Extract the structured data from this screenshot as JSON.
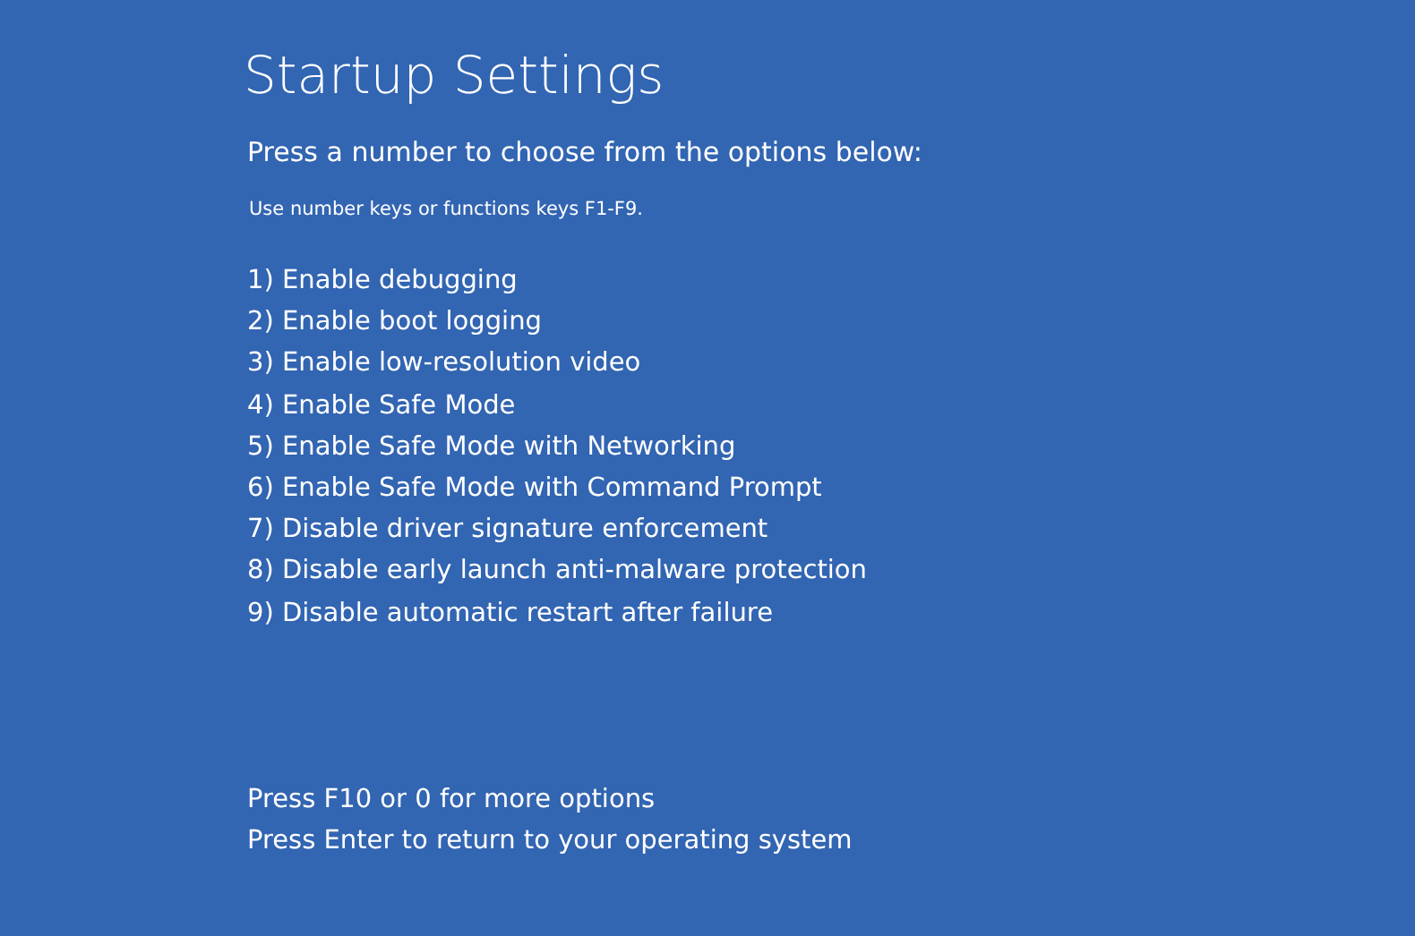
{
  "title": "Startup Settings",
  "prompt": "Press a number to choose from the options below:",
  "hint": "Use number keys or functions keys F1-F9.",
  "options": [
    "1) Enable debugging",
    "2) Enable boot logging",
    "3) Enable low-resolution video",
    "4) Enable Safe Mode",
    "5) Enable Safe Mode with Networking",
    "6) Enable Safe Mode with Command Prompt",
    "7) Disable driver signature enforcement",
    "8) Disable early launch anti-malware protection",
    "9) Disable automatic restart after failure"
  ],
  "footer": [
    "Press F10 or 0 for more options",
    "Press Enter to return to your operating system"
  ]
}
